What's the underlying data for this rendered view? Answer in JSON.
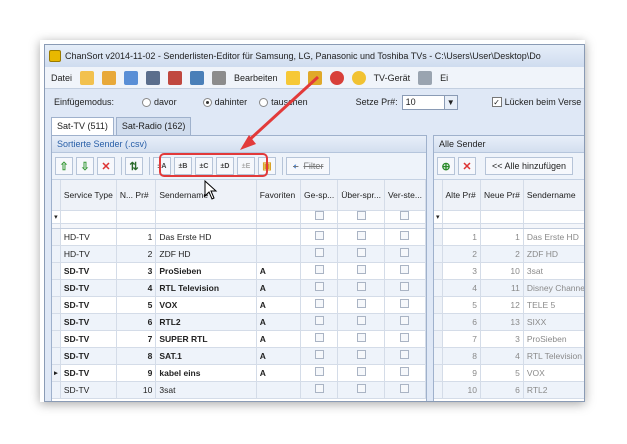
{
  "window": {
    "title": "ChanSort v2014-11-02 - Senderlisten-Editor für Samsung, LG, Panasonic und Toshiba TVs - C:\\Users\\User\\Desktop\\Do"
  },
  "menubar": {
    "items": [
      "Datei",
      "Bearbeiten",
      "TV-Gerät",
      "Ei"
    ],
    "icons": [
      "open-folder-icon",
      "open-recent-icon",
      "reload-icon",
      "save-icon",
      "save-as-icon",
      "export-icon",
      "print-icon",
      "star-icon",
      "lock-icon",
      "forbidden-icon",
      "smiley-icon",
      "wrench-icon"
    ]
  },
  "options": {
    "insert_mode_label": "Einfügemodus:",
    "mode_before": "davor",
    "mode_after": "dahinter",
    "mode_swap": "tauschen",
    "set_nr_label": "Setze Pr#:",
    "set_nr_value": "10",
    "gaps_label": "Lücken beim Verse"
  },
  "tabs": [
    "Sat-TV (511)",
    "Sat-Radio (162)"
  ],
  "left_panel": {
    "title": "Sortierte Sender (.csv)",
    "toolbar_labels": [
      "±A",
      "±B",
      "±C",
      "±D",
      "±E"
    ],
    "filter_label": "Filter",
    "columns": [
      "Service Type",
      "N... Pr#",
      "Sendername",
      "Favoriten",
      "Ge-sp...",
      "Über-spr...",
      "Ver-ste..."
    ],
    "rows": [
      {
        "type": "HD-TV",
        "nr": "1",
        "name": "Das Erste HD",
        "fav": "",
        "bold": false
      },
      {
        "type": "HD-TV",
        "nr": "2",
        "name": "ZDF HD",
        "fav": "",
        "bold": false
      },
      {
        "type": "SD-TV",
        "nr": "3",
        "name": "ProSieben",
        "fav": "A",
        "bold": true
      },
      {
        "type": "SD-TV",
        "nr": "4",
        "name": "RTL Television",
        "fav": "A",
        "bold": true
      },
      {
        "type": "SD-TV",
        "nr": "5",
        "name": "VOX",
        "fav": "A",
        "bold": true
      },
      {
        "type": "SD-TV",
        "nr": "6",
        "name": "RTL2",
        "fav": "A",
        "bold": true
      },
      {
        "type": "SD-TV",
        "nr": "7",
        "name": "SUPER RTL",
        "fav": "A",
        "bold": true
      },
      {
        "type": "SD-TV",
        "nr": "8",
        "name": "SAT.1",
        "fav": "A",
        "bold": true
      },
      {
        "type": "SD-TV",
        "nr": "9",
        "name": "kabel eins",
        "fav": "A",
        "bold": true
      },
      {
        "type": "SD-TV",
        "nr": "10",
        "name": "3sat",
        "fav": "",
        "bold": false
      }
    ]
  },
  "right_panel": {
    "title": "Alle Sender",
    "add_all_label": "<< Alle hinzufügen",
    "columns": [
      "Alte Pr#",
      "Neue Pr#",
      "Sendername"
    ],
    "rows": [
      {
        "old": "1",
        "new": "1",
        "name": "Das Erste HD"
      },
      {
        "old": "2",
        "new": "2",
        "name": "ZDF HD"
      },
      {
        "old": "3",
        "new": "10",
        "name": "3sat"
      },
      {
        "old": "4",
        "new": "11",
        "name": "Disney Channe"
      },
      {
        "old": "5",
        "new": "12",
        "name": "TELE 5"
      },
      {
        "old": "6",
        "new": "13",
        "name": "SIXX"
      },
      {
        "old": "7",
        "new": "3",
        "name": "ProSieben"
      },
      {
        "old": "8",
        "new": "4",
        "name": "RTL Television"
      },
      {
        "old": "9",
        "new": "5",
        "name": "VOX"
      },
      {
        "old": "10",
        "new": "6",
        "name": "RTL2"
      }
    ]
  },
  "colors": {
    "annotation": "#e23a3a",
    "accent": "#2a60a8"
  }
}
